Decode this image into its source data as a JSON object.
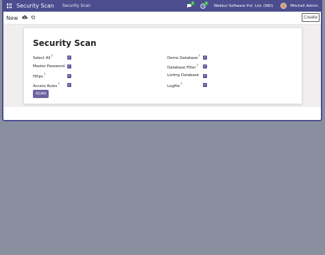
{
  "navbar": {
    "app_name": "Security Scan",
    "menu_item": "Security Scan",
    "chat_badge": "5",
    "activity_badge": "0",
    "company": "Webkul Software Pvt. Ltd. (IND)",
    "user": "Mitchell Admin"
  },
  "control_panel": {
    "breadcrumb": "New",
    "create_label": "Create"
  },
  "form": {
    "title": "Security Scan",
    "left_fields": [
      {
        "label": "Select All",
        "help": "?",
        "checked": true
      },
      {
        "label": "Master Password",
        "help": "",
        "checked": true
      },
      {
        "label": "Https",
        "help": "?",
        "checked": true
      },
      {
        "label": "Access Rules",
        "help": "?",
        "checked": true
      }
    ],
    "right_fields": [
      {
        "label": "Demo Database",
        "help": "?",
        "checked": true
      },
      {
        "label": "Database Filter",
        "help": "?",
        "checked": true
      },
      {
        "label": "Listing Database",
        "help": "",
        "checked": true
      },
      {
        "label": "Logfile",
        "help": "?",
        "checked": true
      }
    ],
    "scan_label": "SCAN"
  },
  "colors": {
    "navbar": "#4b4d8f",
    "checkbox": "#5d5a9b",
    "scan_button": "#6b62a0",
    "badge": "#28a745"
  }
}
